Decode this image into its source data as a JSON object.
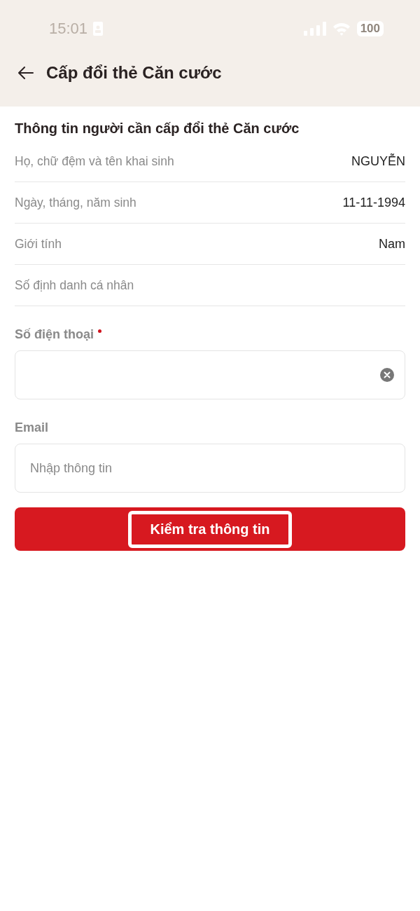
{
  "status_bar": {
    "time": "15:01",
    "battery": "100"
  },
  "header": {
    "title": "Cấp đổi thẻ Căn cước"
  },
  "section": {
    "title": "Thông tin người cần cấp đổi thẻ Căn cước",
    "rows": [
      {
        "label": "Họ, chữ đệm và tên khai sinh",
        "value": "NGUYỄN"
      },
      {
        "label": "Ngày, tháng, năm sinh",
        "value": "11-11-1994"
      },
      {
        "label": "Giới tính",
        "value": "Nam"
      },
      {
        "label": "Số định danh cá nhân"
      }
    ]
  },
  "fields": [
    {
      "label": "Số điện thoại",
      "required": true,
      "clear_button": true
    },
    {
      "label": "Email",
      "required": false,
      "clear_button": false,
      "placeholder": "Nhập thông tin"
    }
  ],
  "button": {
    "label": "Kiểm tra thông tin"
  }
}
